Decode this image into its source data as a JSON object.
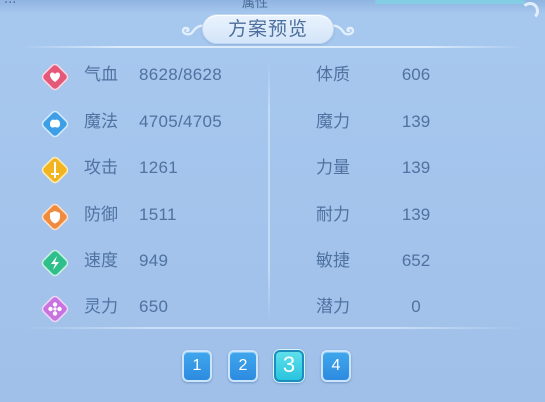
{
  "panel": {
    "title": "方案预览",
    "top_cut_left": "...",
    "top_cut_center": "属性"
  },
  "stats_left": [
    {
      "label": "气血",
      "value": "8628/8628",
      "icon": "heart-icon",
      "color": "#e4587a"
    },
    {
      "label": "魔法",
      "value": "4705/4705",
      "icon": "mana-icon",
      "color": "#3e9fe6"
    },
    {
      "label": "攻击",
      "value": "1261",
      "icon": "sword-icon",
      "color": "#f2b520"
    },
    {
      "label": "防御",
      "value": "1511",
      "icon": "shield-icon",
      "color": "#f08a3c"
    },
    {
      "label": "速度",
      "value": "949",
      "icon": "speed-icon",
      "color": "#2fbf8a"
    },
    {
      "label": "灵力",
      "value": "650",
      "icon": "spirit-icon",
      "color": "#c774e0"
    }
  ],
  "stats_right": [
    {
      "label": "体质",
      "value": "606"
    },
    {
      "label": "魔力",
      "value": "139"
    },
    {
      "label": "力量",
      "value": "139"
    },
    {
      "label": "耐力",
      "value": "139"
    },
    {
      "label": "敏捷",
      "value": "652"
    },
    {
      "label": "潜力",
      "value": "0"
    }
  ],
  "pages": [
    {
      "label": "1",
      "active": false
    },
    {
      "label": "2",
      "active": false
    },
    {
      "label": "3",
      "active": true
    },
    {
      "label": "4",
      "active": false
    }
  ]
}
